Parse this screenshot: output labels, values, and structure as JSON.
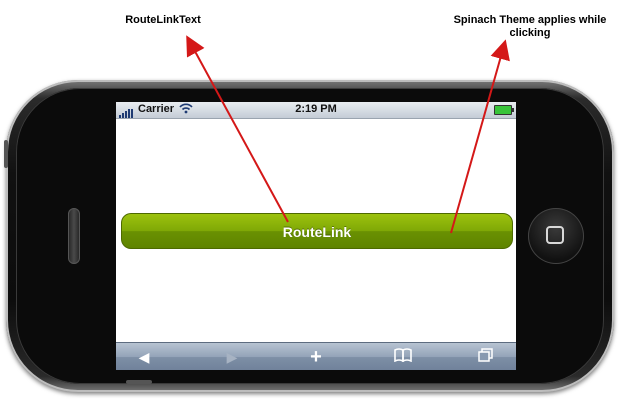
{
  "annotations": {
    "left": "RouteLinkText",
    "right_line1": "Spinach Theme applies while",
    "right_line2": "clicking"
  },
  "status_bar": {
    "carrier": "Carrier",
    "time": "2:19 PM"
  },
  "button": {
    "label": "RouteLink",
    "theme_color": "#7fa806"
  },
  "toolbar": {
    "back_icon": "back-arrow-icon",
    "forward_icon": "forward-arrow-icon",
    "add_icon": "plus-icon",
    "bookmarks_icon": "bookmarks-icon",
    "pages_icon": "pages-icon"
  },
  "colors": {
    "arrow": "#d41818",
    "toolbar": "#8799b0"
  }
}
